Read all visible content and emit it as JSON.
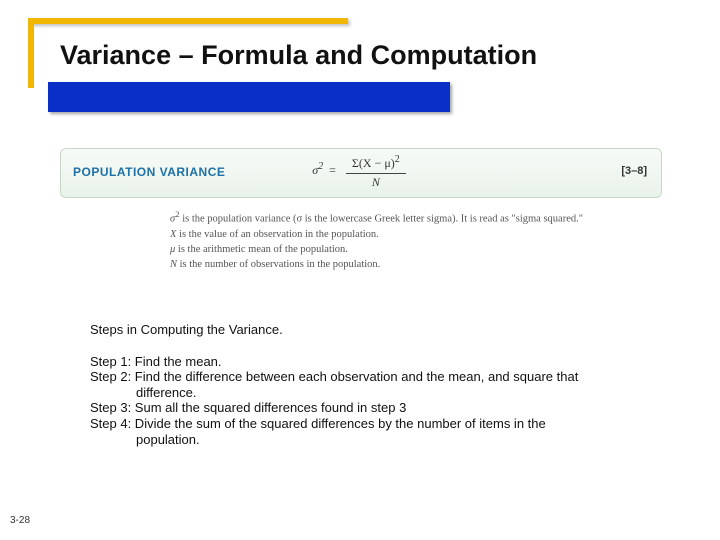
{
  "title": "Variance – Formula and Computation",
  "formula": {
    "label": "POPULATION VARIANCE",
    "lhs": "σ",
    "lhs_exp": "2",
    "numerator_prefix": "Σ(",
    "numerator_x": "X",
    "numerator_minus": " − ",
    "numerator_mu": "μ",
    "numerator_suffix": ")",
    "numerator_exp": "2",
    "denominator": "N",
    "reference": "[3–8]"
  },
  "definitions": {
    "d1a": "σ",
    "d1a_exp": "2",
    "d1b": " is the population variance (σ is the lowercase Greek letter sigma). It is read as \"sigma squared.\"",
    "d2a": "X",
    "d2b": " is the value of an observation in the population.",
    "d3a": "μ",
    "d3b": " is the arithmetic mean of the population.",
    "d4a": "N",
    "d4b": " is the number of observations in the population."
  },
  "steps": {
    "heading": "Steps in Computing the Variance.",
    "s1": "Step 1: Find the mean.",
    "s2a": "Step 2: Find the difference between each observation and the mean, and square that",
    "s2b": "difference.",
    "s3": "Step 3: Sum all the squared differences found in step 3",
    "s4a": "Step 4: Divide the sum of the squared differences by the number of items in the",
    "s4b": "population."
  },
  "page_number": "3-28"
}
